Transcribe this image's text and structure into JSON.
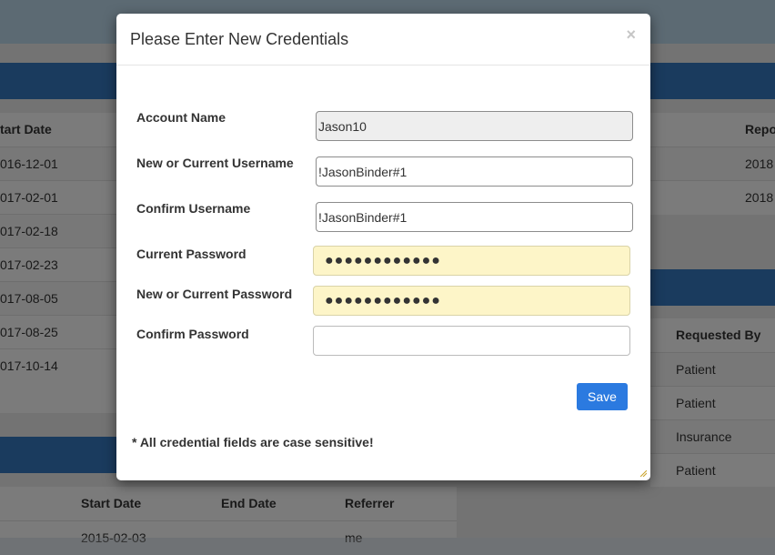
{
  "modal": {
    "title": "Please Enter New Credentials",
    "close_symbol": "×",
    "fields": [
      {
        "label": "Account Name",
        "value": "Jason10",
        "placeholder": ""
      },
      {
        "label": "New or Current Username",
        "value": "!JasonBinder#1",
        "placeholder": ""
      },
      {
        "label": "Confirm Username",
        "value": "!JasonBinder#1",
        "placeholder": ""
      },
      {
        "label": "Current Password",
        "value": "●●●●●●●●●●●●",
        "placeholder": ""
      },
      {
        "label": "New or Current Password",
        "value": "●●●●●●●●●●●●",
        "placeholder": ""
      },
      {
        "label": "Confirm Password",
        "value": "",
        "placeholder": ""
      }
    ],
    "save_label": "Save",
    "note": "* All credential fields are case sensitive!"
  },
  "background": {
    "left_table": {
      "header": "tart Date",
      "rows": [
        "016-12-01",
        "017-02-01",
        "017-02-18",
        "017-02-23",
        "017-08-05",
        "017-08-25",
        "017-10-14"
      ]
    },
    "right_table": {
      "header": "Repo",
      "rows": [
        "2018",
        "2018"
      ]
    },
    "requests_table": {
      "header": "Requested By",
      "rows": [
        "Patient",
        "Patient",
        "Insurance",
        "Patient"
      ]
    },
    "bottom_table": {
      "headers": [
        "Start Date",
        "End Date",
        "Referrer"
      ],
      "partial_row": [
        "2015-02-03",
        "",
        "me"
      ]
    }
  }
}
